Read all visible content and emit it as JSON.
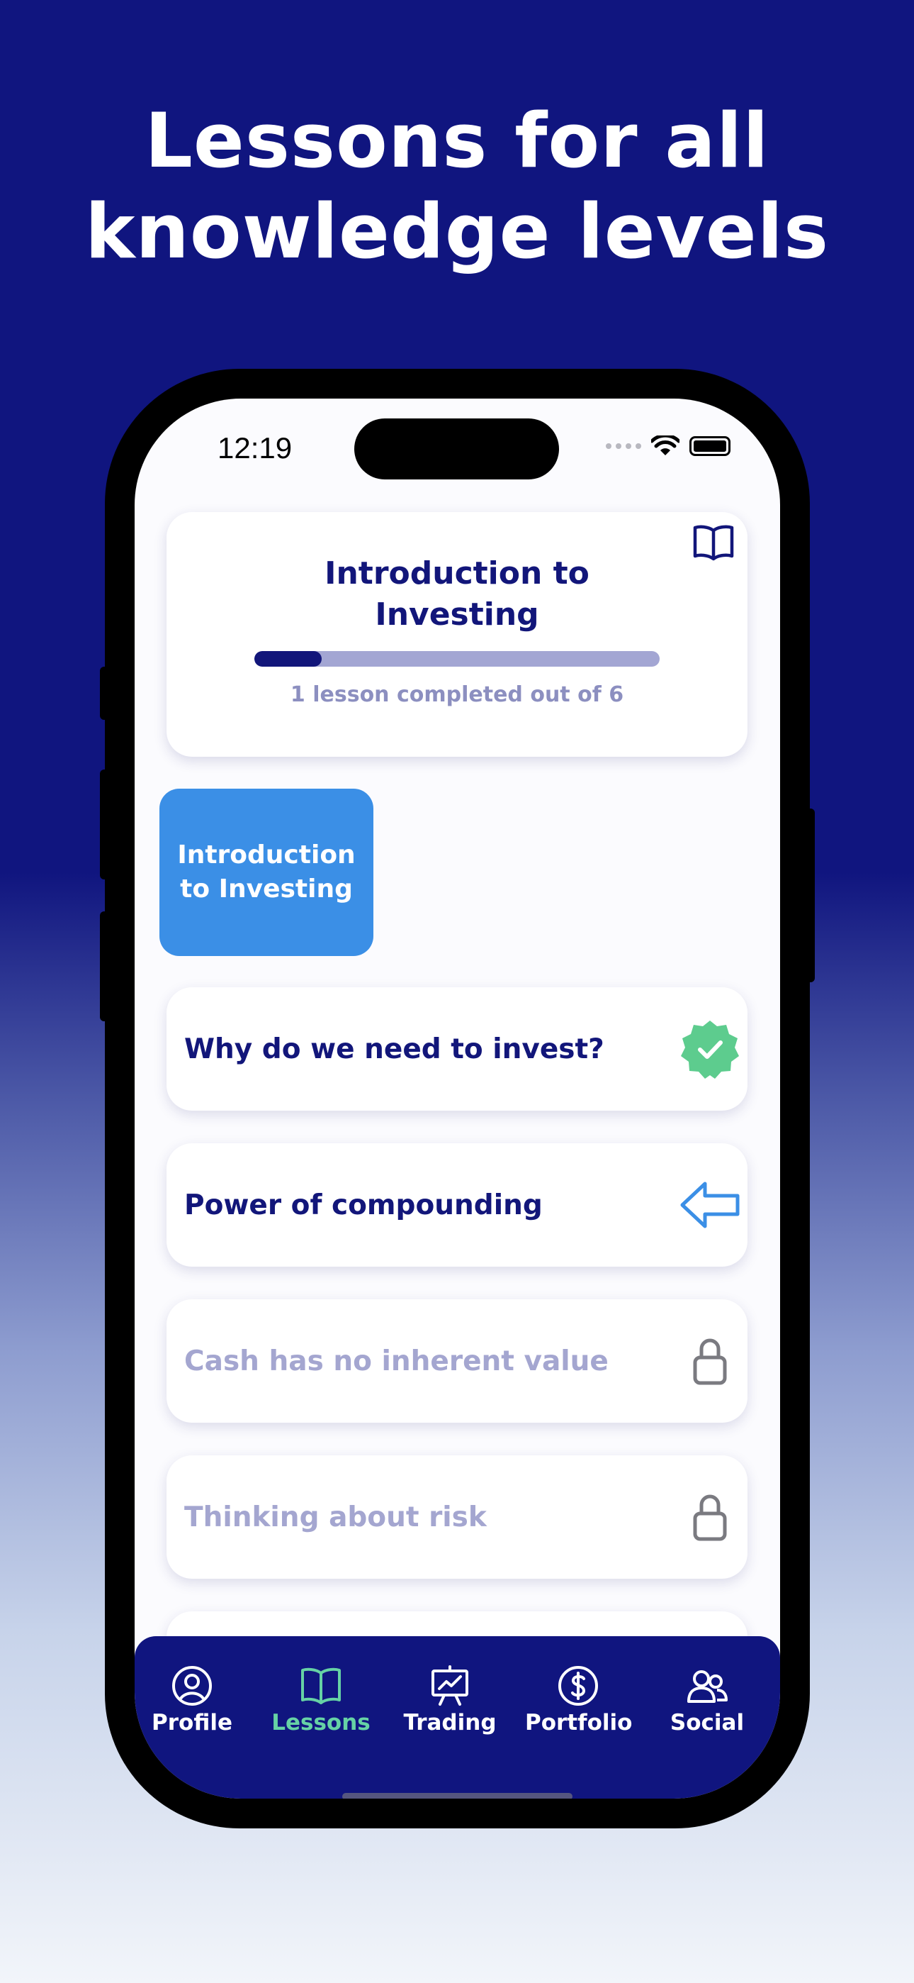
{
  "headline": {
    "line1": "Lessons for all",
    "line2": "knowledge levels"
  },
  "status_bar": {
    "time": "12:19"
  },
  "course": {
    "title_line1": "Introduction to",
    "title_line2": "Investing",
    "progress": 0.1667,
    "progress_text": "1 lesson completed out of 6",
    "icon": "book-icon"
  },
  "unit_tile": {
    "line1": "Introduction",
    "line2": "to Investing"
  },
  "lessons": [
    {
      "label": "Why do we need to invest?",
      "state": "completed",
      "icon": "checkmark-badge-icon"
    },
    {
      "label": "Power of compounding",
      "state": "current",
      "icon": "arrow-left-icon"
    },
    {
      "label": "Cash has no inherent value",
      "state": "locked",
      "icon": "lock-icon"
    },
    {
      "label": "Thinking about risk",
      "state": "locked",
      "icon": "lock-icon"
    }
  ],
  "tabs": [
    {
      "label": "Profile",
      "icon": "profile-icon",
      "active": false
    },
    {
      "label": "Lessons",
      "icon": "book-icon",
      "active": true
    },
    {
      "label": "Trading",
      "icon": "chart-board-icon",
      "active": false
    },
    {
      "label": "Portfolio",
      "icon": "dollar-circle-icon",
      "active": false
    },
    {
      "label": "Social",
      "icon": "people-icon",
      "active": false
    }
  ],
  "colors": {
    "brand_navy": "#10157f",
    "accent_blue": "#3b8fe6",
    "success_green": "#5dcc8e",
    "active_tab": "#66d2a5",
    "locked_text": "#a4a6d0"
  }
}
